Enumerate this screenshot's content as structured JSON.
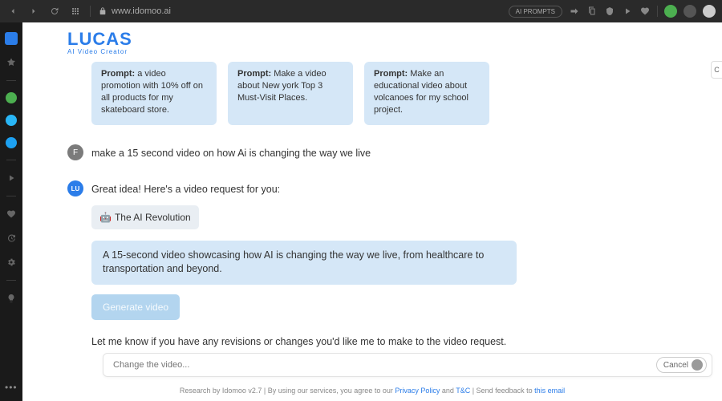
{
  "browser": {
    "url": "www.idomoo.ai",
    "ai_prompts_label": "AI PROMPTS"
  },
  "logo": {
    "title": "LUCAS",
    "subtitle": "AI Video Creator"
  },
  "right_edge_label": "C",
  "prompt_cards": [
    {
      "prefix": "Prompt:",
      "text": " a video promotion with 10% off on all products for my skateboard store."
    },
    {
      "prefix": "Prompt:",
      "text": " Make a video about New york Top 3 Must-Visit Places."
    },
    {
      "prefix": "Prompt:",
      "text": " Make an educational video about volcanoes for my school project."
    }
  ],
  "user_msg": {
    "avatar": "F",
    "text": "make a 15 second video on how Ai is changing the way we live"
  },
  "bot_msg": {
    "avatar": "LU",
    "intro": "Great idea! Here's a video request for you:",
    "chip_emoji": "🤖",
    "chip_text": "The AI Revolution",
    "description": "A 15-second video showcasing how AI is changing the way we live, from healthcare to transportation and beyond.",
    "generate_label": "Generate video",
    "followup": "Let me know if you have any revisions or changes you'd like me to make to the video request."
  },
  "input": {
    "placeholder": "Change the video...",
    "cancel_label": "Cancel"
  },
  "footer": {
    "p1": "Research by Idomoo v2.7 | By using our services, you agree to our ",
    "link1": "Privacy Policy",
    "p2": " and ",
    "link2": "T&C",
    "p3": " | Send feedback to ",
    "link3": "this email"
  }
}
